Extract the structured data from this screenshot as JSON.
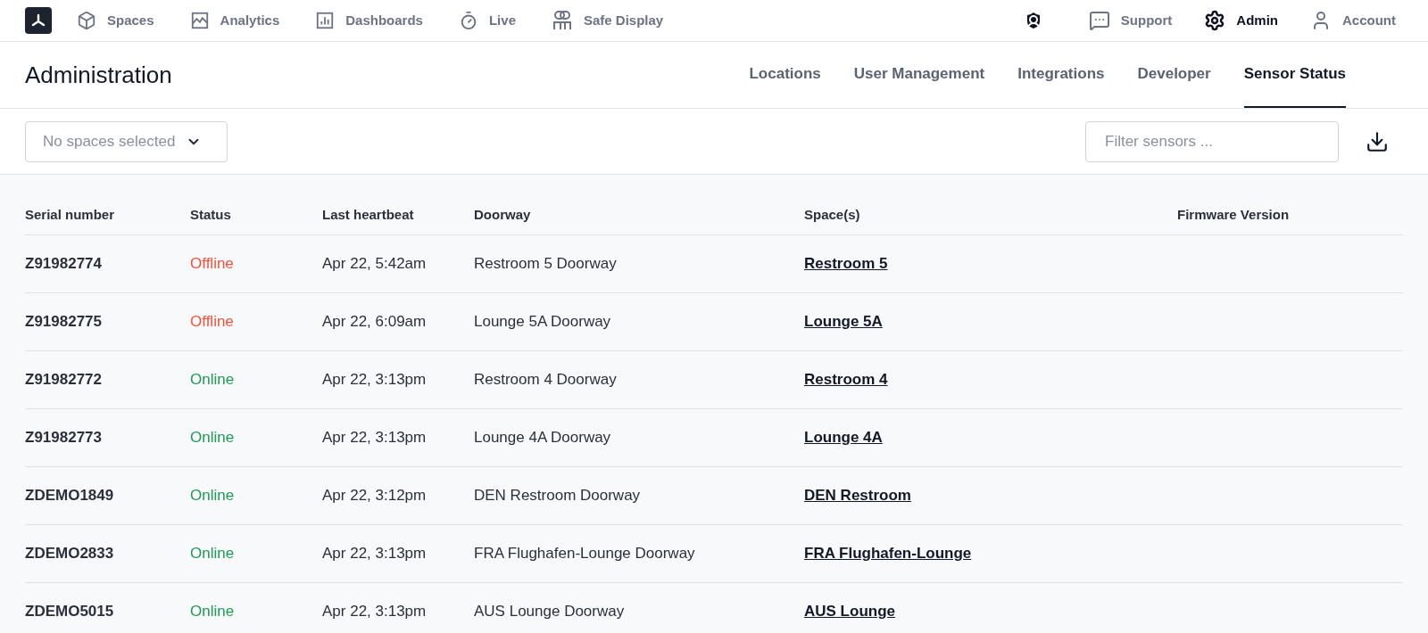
{
  "top_nav": {
    "items": [
      {
        "label": "Spaces",
        "selected": false
      },
      {
        "label": "Analytics",
        "selected": false
      },
      {
        "label": "Dashboards",
        "selected": false
      },
      {
        "label": "Live",
        "selected": false
      },
      {
        "label": "Safe Display",
        "selected": false
      }
    ],
    "right_items": [
      {
        "label": "Support",
        "selected": false
      },
      {
        "label": "Admin",
        "selected": true
      },
      {
        "label": "Account",
        "selected": false
      }
    ]
  },
  "page": {
    "title": "Administration",
    "tabs": [
      {
        "label": "Locations",
        "selected": false
      },
      {
        "label": "User Management",
        "selected": false
      },
      {
        "label": "Integrations",
        "selected": false
      },
      {
        "label": "Developer",
        "selected": false
      },
      {
        "label": "Sensor Status",
        "selected": true
      }
    ]
  },
  "filters": {
    "spaces_dropdown": {
      "placeholder": "No spaces selected"
    },
    "search": {
      "placeholder": "Filter sensors ..."
    }
  },
  "table": {
    "columns": [
      "Serial number",
      "Status",
      "Last heartbeat",
      "Doorway",
      "Space(s)",
      "Firmware Version"
    ],
    "rows": [
      {
        "serial": "Z91982774",
        "status": "Offline",
        "kind": "offline",
        "heartbeat": "Apr 22, 5:42am",
        "doorway": "Restroom 5 Doorway",
        "space": "Restroom 5"
      },
      {
        "serial": "Z91982775",
        "status": "Offline",
        "kind": "offline",
        "heartbeat": "Apr 22, 6:09am",
        "doorway": "Lounge 5A Doorway",
        "space": "Lounge 5A"
      },
      {
        "serial": "Z91982772",
        "status": "Online",
        "kind": "online",
        "heartbeat": "Apr 22, 3:13pm",
        "doorway": "Restroom 4 Doorway",
        "space": "Restroom 4"
      },
      {
        "serial": "Z91982773",
        "status": "Online",
        "kind": "online",
        "heartbeat": "Apr 22, 3:13pm",
        "doorway": "Lounge 4A Doorway",
        "space": "Lounge 4A"
      },
      {
        "serial": "ZDEMO1849",
        "status": "Online",
        "kind": "online",
        "heartbeat": "Apr 22, 3:12pm",
        "doorway": "DEN Restroom Doorway",
        "space": "DEN Restroom"
      },
      {
        "serial": "ZDEMO2833",
        "status": "Online",
        "kind": "online",
        "heartbeat": "Apr 22, 3:13pm",
        "doorway": "FRA Flughafen-Lounge Doorway",
        "space": "FRA Flughafen-Lounge"
      },
      {
        "serial": "ZDEMO5015",
        "status": "Online",
        "kind": "online",
        "heartbeat": "Apr 22, 3:13pm",
        "doorway": "AUS Lounge Doorway",
        "space": "AUS Lounge"
      }
    ]
  }
}
